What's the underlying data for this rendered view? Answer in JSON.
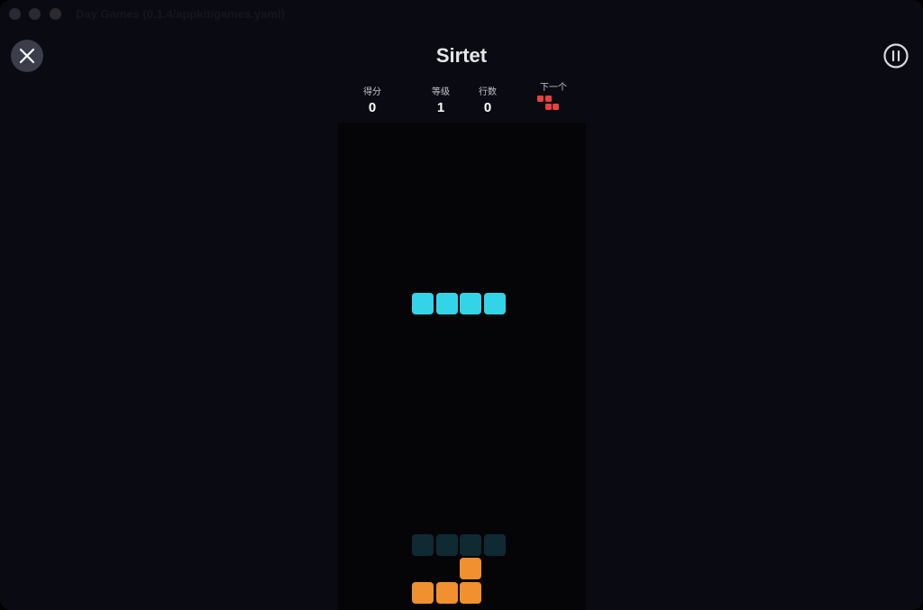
{
  "window": {
    "title": "Day Games (0.1.4/appkit/games.yaml)"
  },
  "header": {
    "title": "Sirtet",
    "close_icon": "close-x-icon",
    "pause_icon": "pause-circle-icon"
  },
  "stats": {
    "score": {
      "label": "得分",
      "value": "0"
    },
    "level": {
      "label": "等级",
      "value": "1"
    },
    "lines": {
      "label": "行数",
      "value": "0"
    }
  },
  "next": {
    "label": "下一个",
    "piece": "Z",
    "color": "#e94040",
    "cells": [
      [
        0,
        0
      ],
      [
        1,
        0
      ],
      [
        1,
        1
      ],
      [
        2,
        1
      ]
    ]
  },
  "board": {
    "cols": 10,
    "rows": 20,
    "active_piece": {
      "type": "I",
      "color": "#34d4e8",
      "cells": [
        [
          3,
          7
        ],
        [
          4,
          7
        ],
        [
          5,
          7
        ],
        [
          6,
          7
        ]
      ]
    },
    "ghost_piece": {
      "color": "#0f2a33",
      "cells": [
        [
          3,
          17
        ],
        [
          4,
          17
        ],
        [
          5,
          17
        ],
        [
          6,
          17
        ]
      ]
    },
    "locked": [
      {
        "color": "#f0902e",
        "cells": [
          [
            5,
            18
          ],
          [
            3,
            19
          ],
          [
            4,
            19
          ],
          [
            5,
            19
          ]
        ]
      }
    ]
  }
}
